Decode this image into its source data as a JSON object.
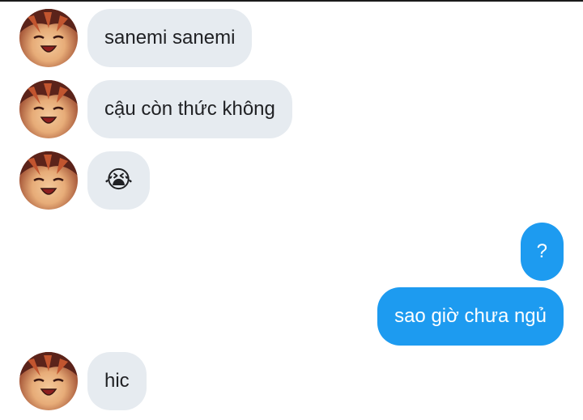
{
  "messages": [
    {
      "from": "them",
      "text": "sanemi sanemi"
    },
    {
      "from": "them",
      "text": "cậu còn thức không"
    },
    {
      "from": "them",
      "text": "😭",
      "icon": "loudly-crying-face-emoji"
    },
    {
      "from": "me",
      "text": "?"
    },
    {
      "from": "me",
      "text": "sao giờ chưa ngủ"
    },
    {
      "from": "them",
      "text": "hic"
    }
  ],
  "colors": {
    "incoming_bubble": "#e6ebf0",
    "outgoing_bubble": "#1d9bf0",
    "incoming_text": "#202124",
    "outgoing_text": "#ffffff"
  }
}
